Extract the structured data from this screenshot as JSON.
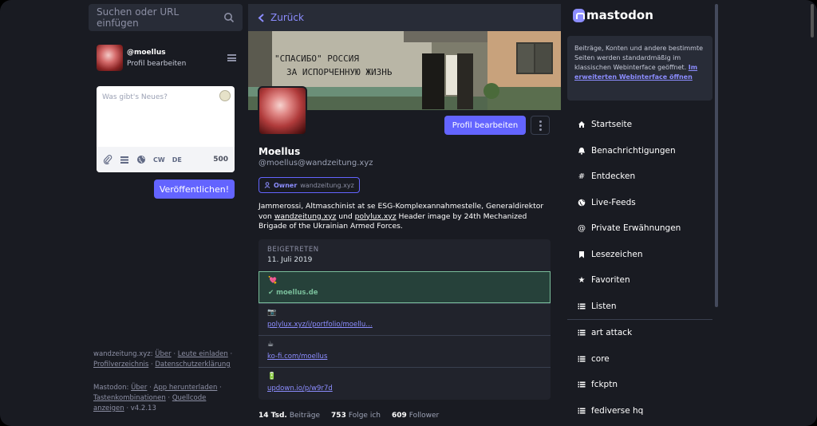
{
  "search": {
    "placeholder": "Suchen oder URL einfügen"
  },
  "me": {
    "name": "@moellus",
    "edit_label": "Profil bearbeiten"
  },
  "compose": {
    "placeholder": "Was gibt's Neues?",
    "cw_label": "CW",
    "lang_label": "DE",
    "char_count": "500",
    "publish_label": "Veröffentlichen!"
  },
  "footer": {
    "server_prefix": "wandzeitung.xyz:",
    "server_links": [
      "Über",
      "Leute einladen",
      "Profilverzeichnis",
      "Datenschutzerklärung"
    ],
    "mastodon_prefix": "Mastodon:",
    "mastodon_links": [
      "Über",
      "App herunterladen",
      "Tastenkombinationen",
      "Quellcode anzeigen"
    ],
    "version": "v4.2.13"
  },
  "column": {
    "back_label": "Zurück"
  },
  "header_image": {
    "graffiti_line1": "\"СПАСИБО\" РОССИЯ",
    "graffiti_line2": "ЗА ИСПОРЧЕННУЮ ЖИЗНЬ"
  },
  "profile": {
    "edit_button": "Profil bearbeiten",
    "display_name": "Moellus",
    "acct": "@moellus@wandzeitung.xyz",
    "role": "Owner",
    "role_domain": "wandzeitung.xyz",
    "bio_part1": "Jammerossi, Altmaschinist at se ESG-Komplexannahmestelle, Generaldirektor von ",
    "bio_link1": "wandzeitung.xyz",
    "bio_part2": " und ",
    "bio_link2": "polylux.xyz",
    "bio_part3": " Header image by 24th Mechanized Brigade of the Ukrainian Armed Forces.",
    "joined_label": "BEIGETRETEN",
    "joined_date": "11. Juli 2019",
    "fields": [
      {
        "icon": "heart-emoji",
        "value": "moellus.de",
        "verified": true
      },
      {
        "icon": "camera-emoji",
        "value": "polylux.xyz/i/portfolio/moellu…",
        "verified": false
      },
      {
        "icon": "coffee-emoji",
        "value": "ko-fi.com/moellus",
        "verified": false
      },
      {
        "icon": "battery-emoji",
        "value": "updown.io/p/w9r7d",
        "verified": false
      }
    ],
    "stats": {
      "posts_count": "14 Tsd.",
      "posts_label": "Beiträge",
      "following_count": "753",
      "following_label": "Folge ich",
      "followers_count": "609",
      "followers_label": "Follower"
    }
  },
  "sidebar": {
    "logo_text": "mastodon",
    "notice_text": "Beiträge, Konten und andere bestimmte Seiten werden standardmäßig im klassischen Webinterface geöffnet.",
    "notice_link": "Im erweiterten Webinterface öffnen",
    "nav": [
      {
        "label": "Startseite",
        "icon": "home-icon"
      },
      {
        "label": "Benachrichtigungen",
        "icon": "bell-icon"
      },
      {
        "label": "Entdecken",
        "icon": "hashtag-icon"
      },
      {
        "label": "Live-Feeds",
        "icon": "globe-icon"
      },
      {
        "label": "Private Erwähnungen",
        "icon": "at-icon"
      },
      {
        "label": "Lesezeichen",
        "icon": "bookmark-icon"
      },
      {
        "label": "Favoriten",
        "icon": "star-icon"
      },
      {
        "label": "Listen",
        "icon": "list-icon"
      }
    ],
    "lists": [
      {
        "label": "art attack"
      },
      {
        "label": "core"
      },
      {
        "label": "fckptn"
      },
      {
        "label": "fediverse hq"
      }
    ]
  },
  "colors": {
    "accent": "#6364ff",
    "link": "#8c8dff",
    "verified": "#79bd9a",
    "panel": "#282c37",
    "background": "#191b22"
  }
}
